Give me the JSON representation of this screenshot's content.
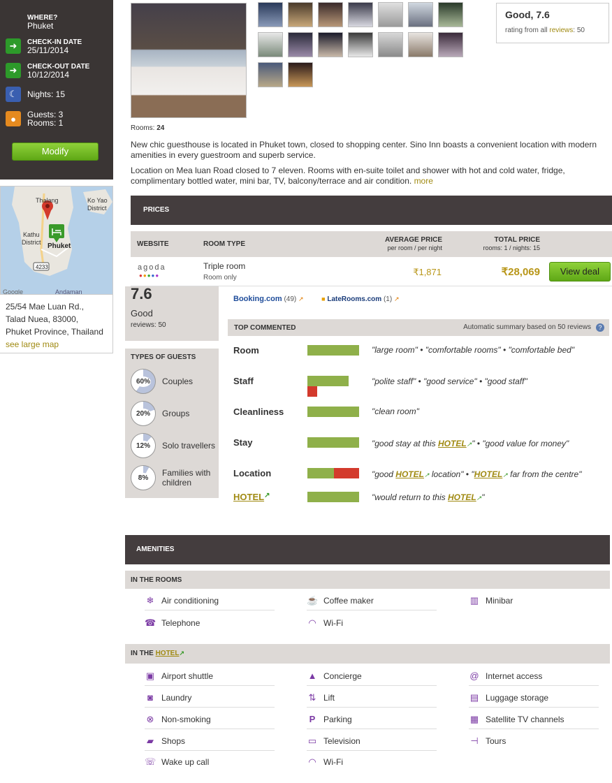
{
  "sidebar": {
    "where_label": "WHERE?",
    "where_value": "Phuket",
    "checkin_label": "CHECK-IN DATE",
    "checkin_value": "25/11/2014",
    "checkout_label": "CHECK-OUT DATE",
    "checkout_value": "10/12/2014",
    "nights": "Nights: 15",
    "guests": "Guests: 3",
    "rooms": "Rooms: 1",
    "modify_label": "Modify"
  },
  "map": {
    "labels": [
      "Thalang",
      "Ko Yao",
      "District",
      "Kathu",
      "District",
      "Phuket",
      "4233",
      "Andaman",
      "Google"
    ]
  },
  "address": {
    "line1": "25/54 Mae Luan Rd.,",
    "line2": "Talad Nuea, 83000,",
    "line3": "Phuket Province, Thailand",
    "map_link": "see large map"
  },
  "rating": {
    "headline": "Good, 7.6",
    "prefix": "rating from all ",
    "link": "reviews",
    "count": ": 50"
  },
  "rooms_count": {
    "label": "Rooms:",
    "value": "24"
  },
  "description": {
    "p1": "New chic guesthouse is located in Phuket town, closed to shopping center. Sino Inn boasts a convenient location with modern amenities in every guestroom and superb service.",
    "p2": "Location on Mea luan Road closed to 7 eleven. Rooms with en-suite toilet and shower with hot and cold water, fridge, complimentary bottled water, mini bar, TV, balcony/terrace and air condition.",
    "more": "more"
  },
  "prices": {
    "header": "PRICES",
    "col_website": "WEBSITE",
    "col_room_type": "ROOM TYPE",
    "col_avg": "AVERAGE PRICE",
    "col_avg_sub": "per room / per night",
    "col_total": "TOTAL PRICE",
    "col_total_sub": "rooms: 1 / nights: 15",
    "row": {
      "site": "agoda",
      "room_type": "Triple room",
      "board": "Room only",
      "avg_price": "₹1,871",
      "total_price": "₹28,069",
      "cta": "View deal"
    }
  },
  "score": {
    "value": "7.6",
    "label": "Good",
    "reviews": "reviews: 50"
  },
  "guest_types": {
    "title": "TYPES OF GUESTS",
    "items": [
      {
        "pct": "60%",
        "label": "Couples",
        "value": 0.6
      },
      {
        "pct": "20%",
        "label": "Groups",
        "value": 0.2
      },
      {
        "pct": "12%",
        "label": "Solo travellers",
        "value": 0.12
      },
      {
        "pct": "8%",
        "label": "Families with children",
        "value": 0.08
      }
    ]
  },
  "sources": [
    {
      "name": "Booking.com",
      "count": "(49)"
    },
    {
      "name": "LateRooms.com",
      "count": "(1)"
    }
  ],
  "top_commented": {
    "title": "TOP COMMENTED",
    "summary": "Automatic summary based on 50 reviews",
    "help": "?",
    "categories": [
      {
        "name": "Room",
        "positive": 1.0,
        "negative": 0,
        "quote": "\"large room\" • \"comfortable rooms\" • \"comfortable bed\""
      },
      {
        "name": "Staff",
        "positive": 0.8,
        "negative": 0.19,
        "quote": "\"polite staff\" • \"good service\" • \"good staff\""
      },
      {
        "name": "Cleanliness",
        "positive": 1.0,
        "negative": 0,
        "quote": "\"clean room\""
      },
      {
        "name": "Stay",
        "positive": 1.0,
        "negative": 0,
        "quote_a": "\"good stay at this ",
        "quote_link": "HOTEL",
        "quote_b": "\" • \"good value for money\""
      },
      {
        "name": "Location",
        "positive": 0.51,
        "negative": 0.49,
        "quote_a": "\"good ",
        "quote_link": "HOTEL",
        "quote_b": " location\" • \"",
        "quote_link2": "HOTEL",
        "quote_c": " far from the centre\""
      },
      {
        "name": "HOTEL",
        "positive": 1.0,
        "negative": 0,
        "quote_a": "\"would return to this ",
        "quote_link": "HOTEL",
        "quote_b": "\""
      }
    ]
  },
  "amenities": {
    "header": "AMENITIES",
    "rooms_title": "IN THE ROOMS",
    "hotel_title_prefix": "IN THE ",
    "hotel_title_link": "HOTEL",
    "rooms": [
      {
        "label": "Air conditioning",
        "icon": "snowflake-icon"
      },
      {
        "label": "Coffee maker",
        "icon": "coffee-icon"
      },
      {
        "label": "Minibar",
        "icon": "minibar-icon"
      },
      {
        "label": "Telephone",
        "icon": "phone-icon"
      },
      {
        "label": "Wi-Fi",
        "icon": "wifi-icon"
      }
    ],
    "hotel": [
      {
        "label": "Airport shuttle",
        "icon": "bus-icon"
      },
      {
        "label": "Concierge",
        "icon": "bell-icon"
      },
      {
        "label": "Internet access",
        "icon": "at-icon"
      },
      {
        "label": "Laundry",
        "icon": "laundry-icon"
      },
      {
        "label": "Lift",
        "icon": "lift-icon"
      },
      {
        "label": "Luggage storage",
        "icon": "luggage-icon"
      },
      {
        "label": "Non-smoking",
        "icon": "no-smoking-icon"
      },
      {
        "label": "Parking",
        "icon": "parking-icon"
      },
      {
        "label": "Satellite TV channels",
        "icon": "satellite-icon"
      },
      {
        "label": "Shops",
        "icon": "shop-icon"
      },
      {
        "label": "Television",
        "icon": "tv-icon"
      },
      {
        "label": "Tours",
        "icon": "signpost-icon"
      },
      {
        "label": "Wake up call",
        "icon": "alarm-phone-icon"
      },
      {
        "label": "Wi-Fi",
        "icon": "wifi-icon"
      }
    ]
  },
  "colors": {
    "accent_green": "#6cb51f",
    "dark": "#443d3e",
    "panel": "#ddd9d6",
    "link": "#a08a12",
    "price": "#b89618",
    "neg": "#d33a2c",
    "icon_purple": "#7b3aa4"
  }
}
